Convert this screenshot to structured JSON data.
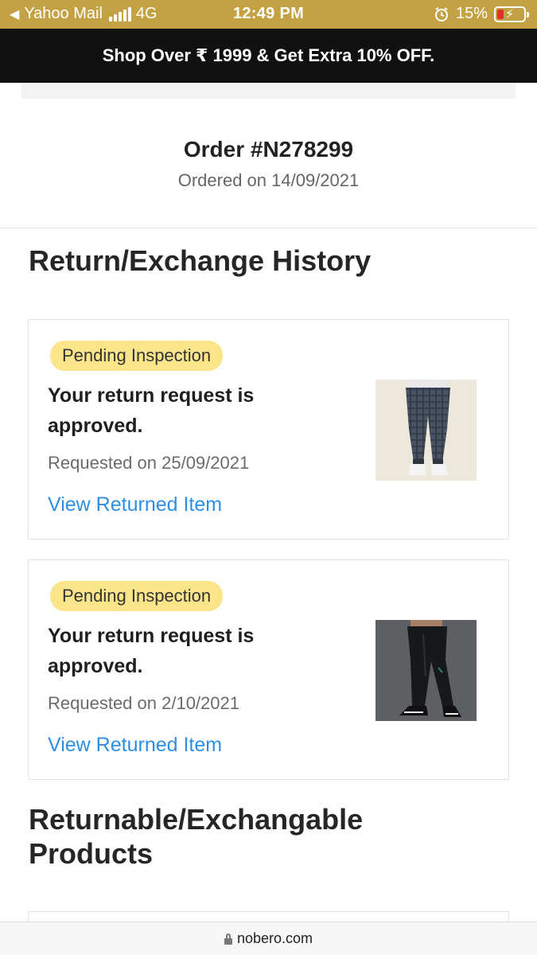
{
  "status_bar": {
    "back_label": "Yahoo Mail",
    "network": "4G",
    "time": "12:49 PM",
    "battery_percent": "15%",
    "battery_level": 0.15,
    "icons": [
      "back-arrow-icon",
      "signal-icon",
      "alarm-icon",
      "battery-charging-icon"
    ],
    "colors": {
      "background": "#c4a243",
      "battery_low": "#e0302a"
    }
  },
  "promo": {
    "text": "Shop Over ₹ 1999 & Get Extra 10% OFF."
  },
  "order": {
    "title": "Order #N278299",
    "date": "Ordered on 14/09/2021"
  },
  "history": {
    "title": "Return/Exchange History",
    "items": [
      {
        "badge": "Pending Inspection",
        "message": "Your return request is approved.",
        "requested": "Requested on 25/09/2021",
        "link": "View Returned Item",
        "image": "checked grey jogger pants on light background"
      },
      {
        "badge": "Pending Inspection",
        "message": "Your return request is approved.",
        "requested": "Requested on 2/10/2021",
        "link": "View Returned Item",
        "image": "black track pants on dark background"
      }
    ]
  },
  "returnable": {
    "title": "Returnable/Exchangable Products"
  },
  "browser": {
    "url": "nobero.com"
  },
  "colors": {
    "badge": "#fbe58a",
    "link": "#2d8fe3",
    "promo_bg": "#111111"
  }
}
